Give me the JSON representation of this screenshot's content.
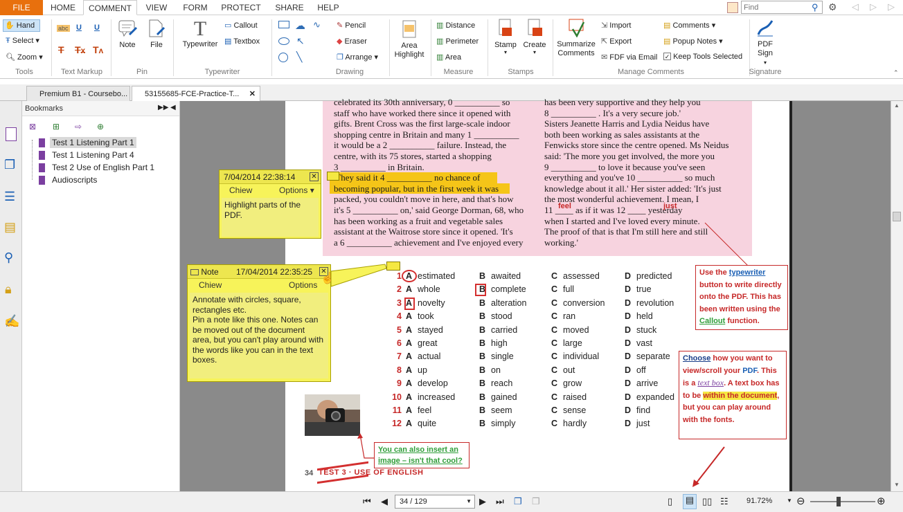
{
  "menu": {
    "file": "FILE",
    "tabs": [
      "HOME",
      "COMMENT",
      "VIEW",
      "FORM",
      "PROTECT",
      "SHARE",
      "HELP"
    ],
    "active": "COMMENT"
  },
  "search": {
    "placeholder": "Find"
  },
  "ribbon": {
    "tools": {
      "hand": "Hand",
      "select": "Select",
      "zoom": "Zoom",
      "label": "Tools"
    },
    "markup_label": "Text Markup",
    "pin": {
      "note": "Note",
      "file": "File",
      "label": "Pin"
    },
    "typewriter": {
      "typewriter": "Typewriter",
      "callout": "Callout",
      "textbox": "Textbox",
      "label": "Typewriter"
    },
    "drawing": {
      "pencil": "Pencil",
      "eraser": "Eraser",
      "arrange": "Arrange",
      "area_highlight": "Area Highlight",
      "label": "Drawing"
    },
    "measure": {
      "distance": "Distance",
      "perimeter": "Perimeter",
      "area": "Area",
      "label": "Measure"
    },
    "stamps": {
      "stamp": "Stamp",
      "create": "Create",
      "label": "Stamps"
    },
    "manage": {
      "summarize": "Summarize Comments",
      "import": "Import",
      "export": "Export",
      "fdf": "FDF via Email",
      "comments": "Comments",
      "popup": "Popup Notes",
      "keep": "Keep Tools Selected",
      "label": "Manage Comments"
    },
    "signature": {
      "pdf_sign": "PDF Sign",
      "label": "Signature"
    }
  },
  "doc_tabs": [
    "Premium B1 - Coursebo...",
    "53155685-FCE-Practice-T..."
  ],
  "bookmarks": {
    "title": "Bookmarks",
    "items": [
      "Test 1 Listening Part 1",
      "Test 1 Listening Part 4",
      "Test 2 Use of English Part 1",
      "Audioscripts"
    ]
  },
  "pdf": {
    "left_col": [
      "celebrated its 30th anniversary, 0 __________ so",
      "staff who have worked there since it opened with",
      "gifts. Brent Cross was the first large-scale indoor",
      "shopping centre in Britain and many 1 __________",
      "it would be a 2 __________ failure. Instead, the",
      "centre, with its 75 stores, started a shopping",
      "3 __________ in Britain.",
      "'They said it 4 __________ no chance of",
      "becoming popular, but in the first week it was",
      "packed, you couldn't move in here, and that's how",
      "it's 5 __________ on,' said George Dorman, 68, who",
      "has been working as a fruit and vegetable sales",
      "assistant at the Waitrose store since it opened. 'It's",
      "a 6 __________ achievement and I've enjoyed every"
    ],
    "right_col": [
      "has been very supportive and they help you",
      "8 __________ . It's a very secure job.'",
      "  Sisters Jeanette Harris and Lydia Neidus have",
      "both been working as sales assistants at the",
      "Fenwicks store since the centre opened. Ms Neidus",
      "said: 'The more you get involved, the more you",
      "9 __________ to love it because you've seen",
      "everything and you've 10 __________ so much",
      "knowledge about it all.' Her sister added: 'It's just",
      "the most wonderful achievement. I mean, I",
      "11 ____ as if it was 12 ____ yesterday",
      "when I started and I've loved every minute.",
      "The proof of that is that I'm still here and still",
      "working.'"
    ],
    "typed_feel": "feel",
    "typed_just": "just",
    "options": [
      {
        "n": "1",
        "a": "estimated",
        "b": "awaited",
        "c": "assessed",
        "d": "predicted"
      },
      {
        "n": "2",
        "a": "whole",
        "b": "complete",
        "c": "full",
        "d": "true"
      },
      {
        "n": "3",
        "a": "novelty",
        "b": "alteration",
        "c": "conversion",
        "d": "revolution"
      },
      {
        "n": "4",
        "a": "took",
        "b": "stood",
        "c": "ran",
        "d": "held"
      },
      {
        "n": "5",
        "a": "stayed",
        "b": "carried",
        "c": "moved",
        "d": "stuck"
      },
      {
        "n": "6",
        "a": "great",
        "b": "high",
        "c": "large",
        "d": "vast"
      },
      {
        "n": "7",
        "a": "actual",
        "b": "single",
        "c": "individual",
        "d": "separate"
      },
      {
        "n": "8",
        "a": "up",
        "b": "on",
        "c": "out",
        "d": "off"
      },
      {
        "n": "9",
        "a": "develop",
        "b": "reach",
        "c": "grow",
        "d": "arrive"
      },
      {
        "n": "10",
        "a": "increased",
        "b": "gained",
        "c": "raised",
        "d": "expanded"
      },
      {
        "n": "11",
        "a": "feel",
        "b": "seem",
        "c": "sense",
        "d": "find"
      },
      {
        "n": "12",
        "a": "quite",
        "b": "simply",
        "c": "hardly",
        "d": "just"
      }
    ],
    "letters": [
      "A",
      "B",
      "C",
      "D"
    ],
    "page_number": "34",
    "footer_text": "TEST 3 · USE OF ENGLISH"
  },
  "notes": [
    {
      "date": "7/04/2014 22:38:14",
      "author": "Chiew",
      "options": "Options",
      "body": "Highlight parts of the PDF."
    },
    {
      "title": "Note",
      "date": "17/04/2014 22:35:25",
      "author": "Chiew",
      "options": "Options",
      "body": "Annotate with circles, square, rectangles etc.\nPin a note like this one. Notes can be moved out of the document area, but you can't play around with the words like you can in the text boxes."
    }
  ],
  "callouts": {
    "typewriter": {
      "pre": "Use the ",
      "link": "typewriter",
      "mid": " button to write directly onto the PDF. This has been written using the ",
      "link2": "Callout",
      "post": " function."
    },
    "choose": {
      "w1": "Choose",
      "t1": " how you want to view/scroll your ",
      "w2": "PDF",
      "t2": ". This is a ",
      "w3": "text box",
      "t3": ". A text box has to be ",
      "w4": "within the document",
      "t4": ", but you can play around with the fonts."
    },
    "image": "You can also insert an image – isn't that cool?"
  },
  "status": {
    "page": "34 / 129",
    "zoom": "91.72%"
  },
  "colors": {
    "accent": "#e8700d",
    "note": "#f7f35a",
    "annot_red": "#c62828",
    "pink": "#f7d3df"
  }
}
